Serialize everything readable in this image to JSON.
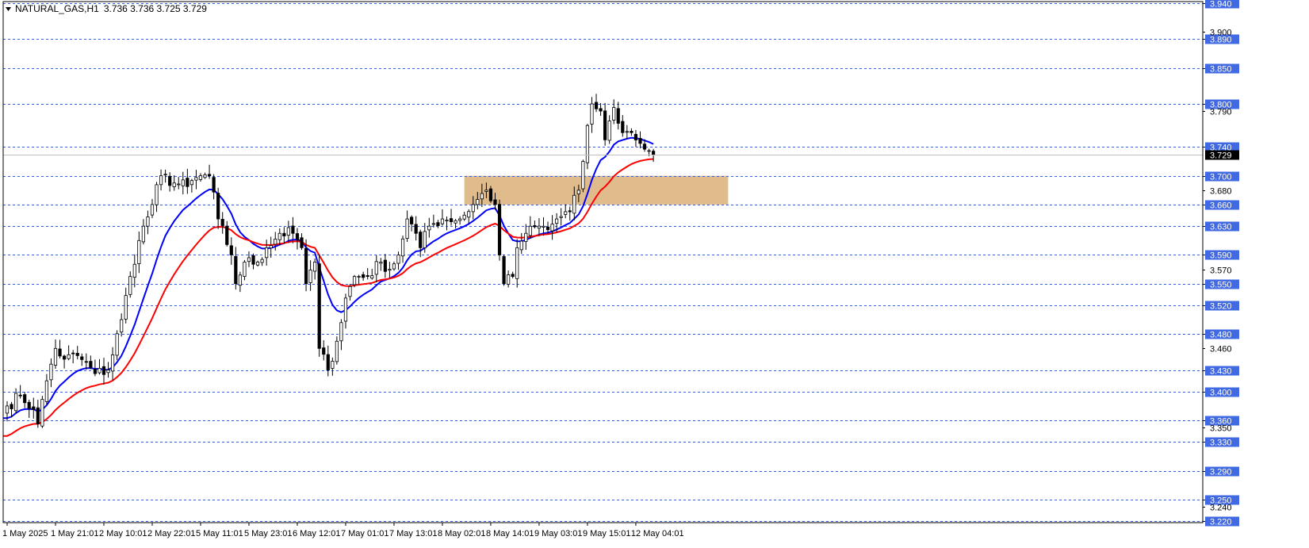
{
  "header": {
    "symbol": "NATURAL_GAS,H1",
    "ohlc": "3.736 3.736 3.725 3.729"
  },
  "colors": {
    "bull_body": "#ffffff",
    "bear_body": "#000000",
    "wick": "#000000",
    "ma_fast": "#0000ff",
    "ma_slow": "#ff0000",
    "grid": "#3b5fcf",
    "level_label_bg": "#4169e1",
    "zone": "#deb887",
    "current_line": "#c0c0c0",
    "current_label_bg": "#000000"
  },
  "chart_data": {
    "type": "candlestick",
    "timeframe": "H1",
    "ylim": [
      3.22,
      3.94
    ],
    "price_levels": [
      3.94,
      3.89,
      3.85,
      3.8,
      3.74,
      3.7,
      3.66,
      3.63,
      3.59,
      3.55,
      3.52,
      3.48,
      3.43,
      3.4,
      3.36,
      3.33,
      3.29,
      3.25,
      3.22
    ],
    "price_level_labels": [
      "3.940",
      "3.890",
      "3.850",
      "3.800",
      "3.740",
      "3.700",
      "3.660",
      "3.630",
      "3.590",
      "3.550",
      "3.520",
      "3.480",
      "3.430",
      "3.400",
      "3.360",
      "3.330",
      "3.290",
      "3.250",
      "3.220"
    ],
    "axis_ticks": [
      3.9,
      3.79,
      3.68,
      3.57,
      3.46,
      3.35,
      3.24
    ],
    "axis_tick_labels": [
      "3.900",
      "3.790",
      "3.680",
      "3.570",
      "3.460",
      "3.350",
      "3.240"
    ],
    "current_price": 3.729,
    "current_price_label": "3.729",
    "zone": {
      "low": 3.66,
      "high": 3.7,
      "from_index": 104,
      "to_index": 164
    },
    "x_labels": [
      {
        "index": 0,
        "label": "1 May 2025"
      },
      {
        "index": 11,
        "label": "1 May 21:01"
      },
      {
        "index": 22,
        "label": "2 May 10:01"
      },
      {
        "index": 33,
        "label": "2 May 22:01"
      },
      {
        "index": 44,
        "label": "5 May 11:01"
      },
      {
        "index": 55,
        "label": "5 May 23:01"
      },
      {
        "index": 66,
        "label": "6 May 12:01"
      },
      {
        "index": 77,
        "label": "7 May 01:01"
      },
      {
        "index": 88,
        "label": "7 May 13:01"
      },
      {
        "index": 99,
        "label": "8 May 02:01"
      },
      {
        "index": 110,
        "label": "8 May 14:01"
      },
      {
        "index": 121,
        "label": "9 May 03:01"
      },
      {
        "index": 132,
        "label": "9 May 15:01"
      },
      {
        "index": 143,
        "label": "12 May 04:01"
      }
    ],
    "close_anchors": [
      [
        0,
        3.38
      ],
      [
        3,
        3.395
      ],
      [
        6,
        3.375
      ],
      [
        7,
        3.355
      ],
      [
        9,
        3.415
      ],
      [
        11,
        3.46
      ],
      [
        13,
        3.445
      ],
      [
        16,
        3.45
      ],
      [
        20,
        3.425
      ],
      [
        23,
        3.43
      ],
      [
        26,
        3.5
      ],
      [
        28,
        3.56
      ],
      [
        30,
        3.61
      ],
      [
        33,
        3.66
      ],
      [
        35,
        3.7
      ],
      [
        38,
        3.69
      ],
      [
        41,
        3.685
      ],
      [
        44,
        3.7
      ],
      [
        46,
        3.7
      ],
      [
        48,
        3.64
      ],
      [
        51,
        3.59
      ],
      [
        52,
        3.55
      ],
      [
        54,
        3.58
      ],
      [
        57,
        3.58
      ],
      [
        59,
        3.6
      ],
      [
        62,
        3.62
      ],
      [
        65,
        3.62
      ],
      [
        67,
        3.6
      ],
      [
        68,
        3.55
      ],
      [
        70,
        3.58
      ],
      [
        71,
        3.46
      ],
      [
        73,
        3.43
      ],
      [
        75,
        3.47
      ],
      [
        77,
        3.53
      ],
      [
        79,
        3.56
      ],
      [
        82,
        3.56
      ],
      [
        85,
        3.58
      ],
      [
        87,
        3.57
      ],
      [
        89,
        3.59
      ],
      [
        91,
        3.64
      ],
      [
        93,
        3.62
      ],
      [
        94,
        3.6
      ],
      [
        96,
        3.63
      ],
      [
        99,
        3.64
      ],
      [
        103,
        3.64
      ],
      [
        106,
        3.66
      ],
      [
        109,
        3.68
      ],
      [
        111,
        3.66
      ],
      [
        112,
        3.59
      ],
      [
        113,
        3.55
      ],
      [
        115,
        3.56
      ],
      [
        116,
        3.6
      ],
      [
        118,
        3.62
      ],
      [
        121,
        3.63
      ],
      [
        123,
        3.625
      ],
      [
        125,
        3.64
      ],
      [
        128,
        3.65
      ],
      [
        130,
        3.68
      ],
      [
        131,
        3.72
      ],
      [
        132,
        3.77
      ],
      [
        133,
        3.8
      ],
      [
        135,
        3.79
      ],
      [
        136,
        3.75
      ],
      [
        138,
        3.795
      ],
      [
        140,
        3.76
      ],
      [
        142,
        3.76
      ],
      [
        144,
        3.745
      ],
      [
        146,
        3.735
      ],
      [
        147,
        3.729
      ]
    ],
    "series": [
      {
        "kind": "ma",
        "period": 12,
        "color_key": "ma_fast"
      },
      {
        "kind": "ma",
        "period": 26,
        "color_key": "ma_slow"
      }
    ]
  }
}
